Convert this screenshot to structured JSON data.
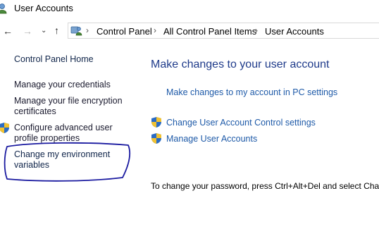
{
  "window": {
    "title": "User Accounts"
  },
  "breadcrumb": [
    "Control Panel",
    "All Control Panel Items",
    "User Accounts"
  ],
  "left_pane": {
    "home": "Control Panel Home",
    "credentials": "Manage your credentials",
    "encryption_line1": "Manage your file encryption",
    "encryption_line2": "certificates",
    "advanced_line1": "Configure advanced user",
    "advanced_line2": "profile properties",
    "env_line1": "Change my environment",
    "env_line2": "variables"
  },
  "main": {
    "heading": "Make changes to your user account",
    "pc_settings_link": "Make changes to my account in PC settings",
    "uac_link": "Change User Account Control settings",
    "manage_link": "Manage User Accounts",
    "info_text": "To change your password, press Ctrl+Alt+Del and select Chan"
  },
  "icons": {
    "title": "user-accounts-icon",
    "shield": "uac-shield-icon"
  },
  "colors": {
    "link": "#1e5aa8",
    "heading": "#1e3a8a",
    "annotation": "#1a1aa0"
  }
}
